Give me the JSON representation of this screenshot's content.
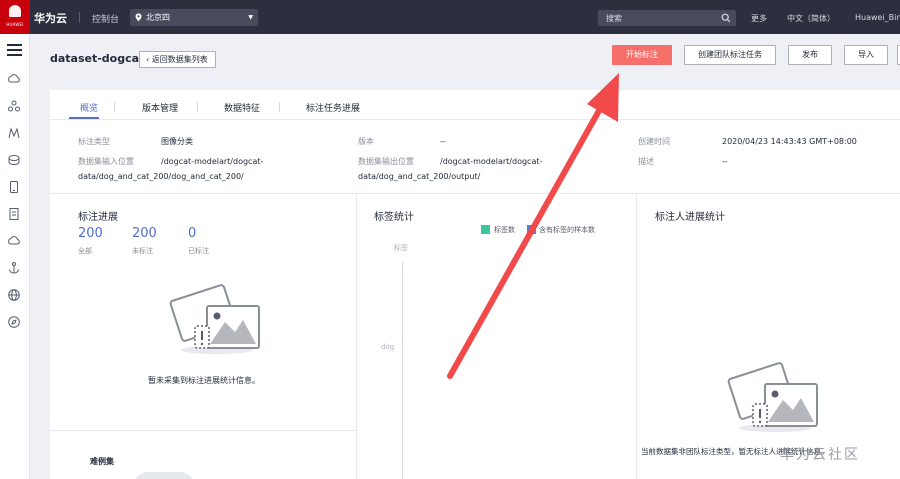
{
  "topbar": {
    "logo_text": "HUAWEI",
    "brand": "华为云",
    "console": "控制台",
    "region": "北京四",
    "search_placeholder": "搜索",
    "menu": [
      "更多",
      "中文（简体）",
      "Huawei_Bin"
    ]
  },
  "header": {
    "title": "dataset-dogcat",
    "back_label": "返回数据集列表",
    "buttons": {
      "start_label": "开始标注",
      "team_label": "创建团队标注任务",
      "publish_label": "发布",
      "import_label": "导入"
    }
  },
  "tabs": [
    "概览",
    "版本管理",
    "数据特征",
    "标注任务进展"
  ],
  "info": {
    "type_key": "标注类型",
    "type_value": "图像分类",
    "version_key": "版本",
    "version_value": "--",
    "created_key": "创建时间",
    "created_value": "2020/04/23 14:43:43 GMT+08:00",
    "input_key": "数据集输入位置",
    "input_value_1": "/dogcat-modelart/dogcat-",
    "input_value_2": "data/dog_and_cat_200/dog_and_cat_200/",
    "output_key": "数据集输出位置",
    "output_value_1": "/dogcat-modelart/dogcat-",
    "output_value_2": "data/dog_and_cat_200/output/",
    "desc_key": "描述",
    "desc_value": "--"
  },
  "progress": {
    "title": "标注进展",
    "stats": [
      {
        "value": "200",
        "label": "全部"
      },
      {
        "value": "200",
        "label": "未标注"
      },
      {
        "value": "0",
        "label": "已标注"
      }
    ],
    "empty_text": "暂未采集到标注进展统计信息。",
    "bottom_title": "难例集"
  },
  "label_stats": {
    "title": "标签统计",
    "legend": [
      {
        "label": "标签数",
        "color": "#3bc6a0"
      },
      {
        "label": "含有标签的样本数",
        "color": "#5a7bd6"
      }
    ],
    "axis_label": "标签",
    "category": "dog"
  },
  "annotator": {
    "title": "标注人进展统计",
    "empty_text": "当前数据集非团队标注类型，暂无标注人进展统计信息。"
  },
  "watermark": "华为云社区",
  "colors": {
    "topbar": "#2c2f3e",
    "accent": "#526ecc",
    "primary_button": "#f66f6a",
    "arrow": "#f24a4a"
  }
}
